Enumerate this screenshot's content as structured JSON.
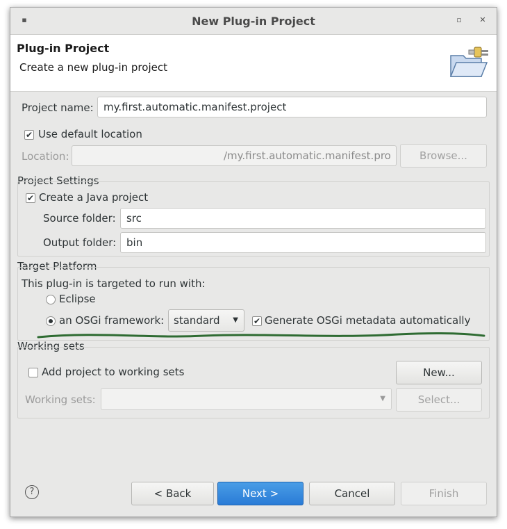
{
  "window": {
    "title": "New Plug-in Project"
  },
  "header": {
    "title": "Plug-in Project",
    "subtitle": "Create a new plug-in project",
    "icon": "folder-plug-icon"
  },
  "project": {
    "name_label": "Project name:",
    "name_value": "my.first.automatic.manifest.project",
    "use_default_label": "Use default location",
    "use_default_checked": true,
    "location_label": "Location:",
    "location_value": "/my.first.automatic.manifest.pro",
    "browse_label": "Browse..."
  },
  "project_settings": {
    "group_label": "Project Settings",
    "create_java_label": "Create a Java project",
    "create_java_checked": true,
    "source_label": "Source folder:",
    "source_value": "src",
    "output_label": "Output folder:",
    "output_value": "bin"
  },
  "target_platform": {
    "group_label": "Target Platform",
    "intro": "This plug-in is targeted to run with:",
    "eclipse_label": "Eclipse",
    "osgi_label": "an OSGi framework:",
    "osgi_selected": true,
    "framework_value": "standard",
    "generate_label": "Generate OSGi metadata automatically",
    "generate_checked": true
  },
  "working_sets": {
    "group_label": "Working sets",
    "add_label": "Add project to working sets",
    "add_checked": false,
    "new_label": "New...",
    "sets_label": "Working sets:",
    "select_label": "Select..."
  },
  "footer": {
    "help_label": "?",
    "back_label": "< Back",
    "next_label": "Next >",
    "cancel_label": "Cancel",
    "finish_label": "Finish"
  },
  "colors": {
    "annotation_underline": "#2e6b32",
    "primary_button": "#2a7bd6"
  }
}
